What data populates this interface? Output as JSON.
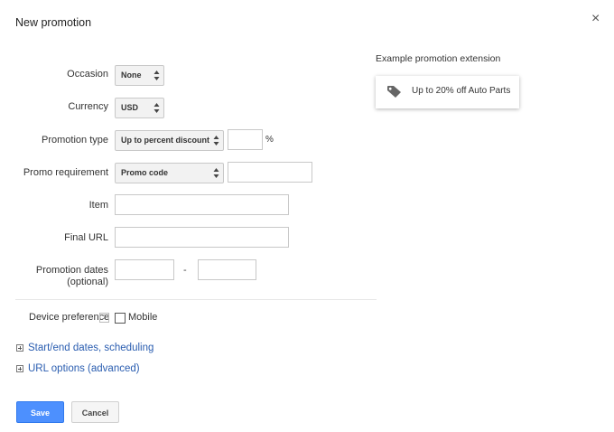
{
  "dialog": {
    "title": "New promotion",
    "close_label": "×"
  },
  "form": {
    "occasion": {
      "label": "Occasion",
      "value": "None"
    },
    "currency": {
      "label": "Currency",
      "value": "USD"
    },
    "promotion_type": {
      "label": "Promotion type",
      "value": "Up to percent discount",
      "percent_value": "",
      "unit": "%"
    },
    "promo_requirement": {
      "label": "Promo requirement",
      "value": "Promo code",
      "code_value": ""
    },
    "item": {
      "label": "Item",
      "value": ""
    },
    "final_url": {
      "label": "Final URL",
      "value": ""
    },
    "promotion_dates": {
      "label_line1": "Promotion dates",
      "label_line2": "(optional)",
      "start_value": "",
      "end_value": "",
      "separator": "-"
    },
    "device_preference": {
      "label": "Device preference",
      "help_icon": "?",
      "option_label": "Mobile",
      "checked": false
    }
  },
  "expanders": [
    {
      "label": "Start/end dates, scheduling"
    },
    {
      "label": "URL options (advanced)"
    }
  ],
  "buttons": {
    "save": "Save",
    "cancel": "Cancel"
  },
  "preview": {
    "heading": "Example promotion extension",
    "icon": "tag-icon",
    "text": "Up to 20% off Auto Parts"
  },
  "colors": {
    "primary_button": "#4d90fe",
    "link": "#2a5db0"
  }
}
